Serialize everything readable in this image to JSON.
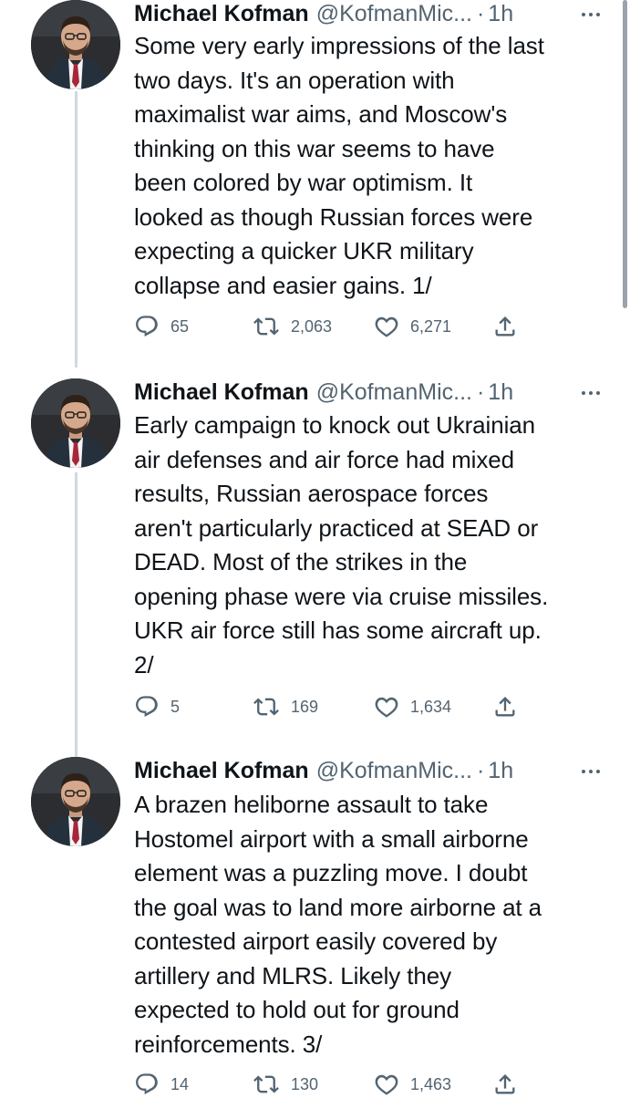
{
  "author": {
    "name": "Michael Kofman",
    "handle": "@KofmanMic...",
    "separator": "·",
    "avatar_icon": "profile-photo-man-in-suit"
  },
  "icons": {
    "more": "more-dots-icon",
    "reply": "reply-icon",
    "retweet": "retweet-icon",
    "like": "heart-icon",
    "share": "share-icon"
  },
  "colors": {
    "text": "#0f1419",
    "secondary": "#536471",
    "thread_line": "#cfd9de"
  },
  "tweets": [
    {
      "time": "1h",
      "text": "Some very early impressions of the last\ntwo days. It's an operation with\nmaximalist war aims, and Moscow's\nthinking on this war seems to have\nbeen colored by war optimism. It\nlooked as though Russian forces were\nexpecting a quicker UKR military\ncollapse and easier gains. 1/",
      "replies": "65",
      "retweets": "2,063",
      "likes": "6,271"
    },
    {
      "time": "1h",
      "text": "Early campaign to knock out Ukrainian\nair defenses and air force had mixed\nresults, Russian aerospace forces\naren't particularly practiced at SEAD or\nDEAD. Most of the strikes in the\nopening phase were via cruise missiles.\nUKR air force still has some aircraft up.\n2/",
      "replies": "5",
      "retweets": "169",
      "likes": "1,634"
    },
    {
      "time": "1h",
      "text": "A brazen heliborne assault to take\nHostomel airport with a small airborne\nelement was a puzzling move. I doubt\nthe goal was to land more airborne at a\ncontested airport easily covered by\nartillery and MLRS. Likely they\nexpected to hold out for ground\nreinforcements. 3/",
      "replies": "14",
      "retweets": "130",
      "likes": "1,463"
    }
  ]
}
